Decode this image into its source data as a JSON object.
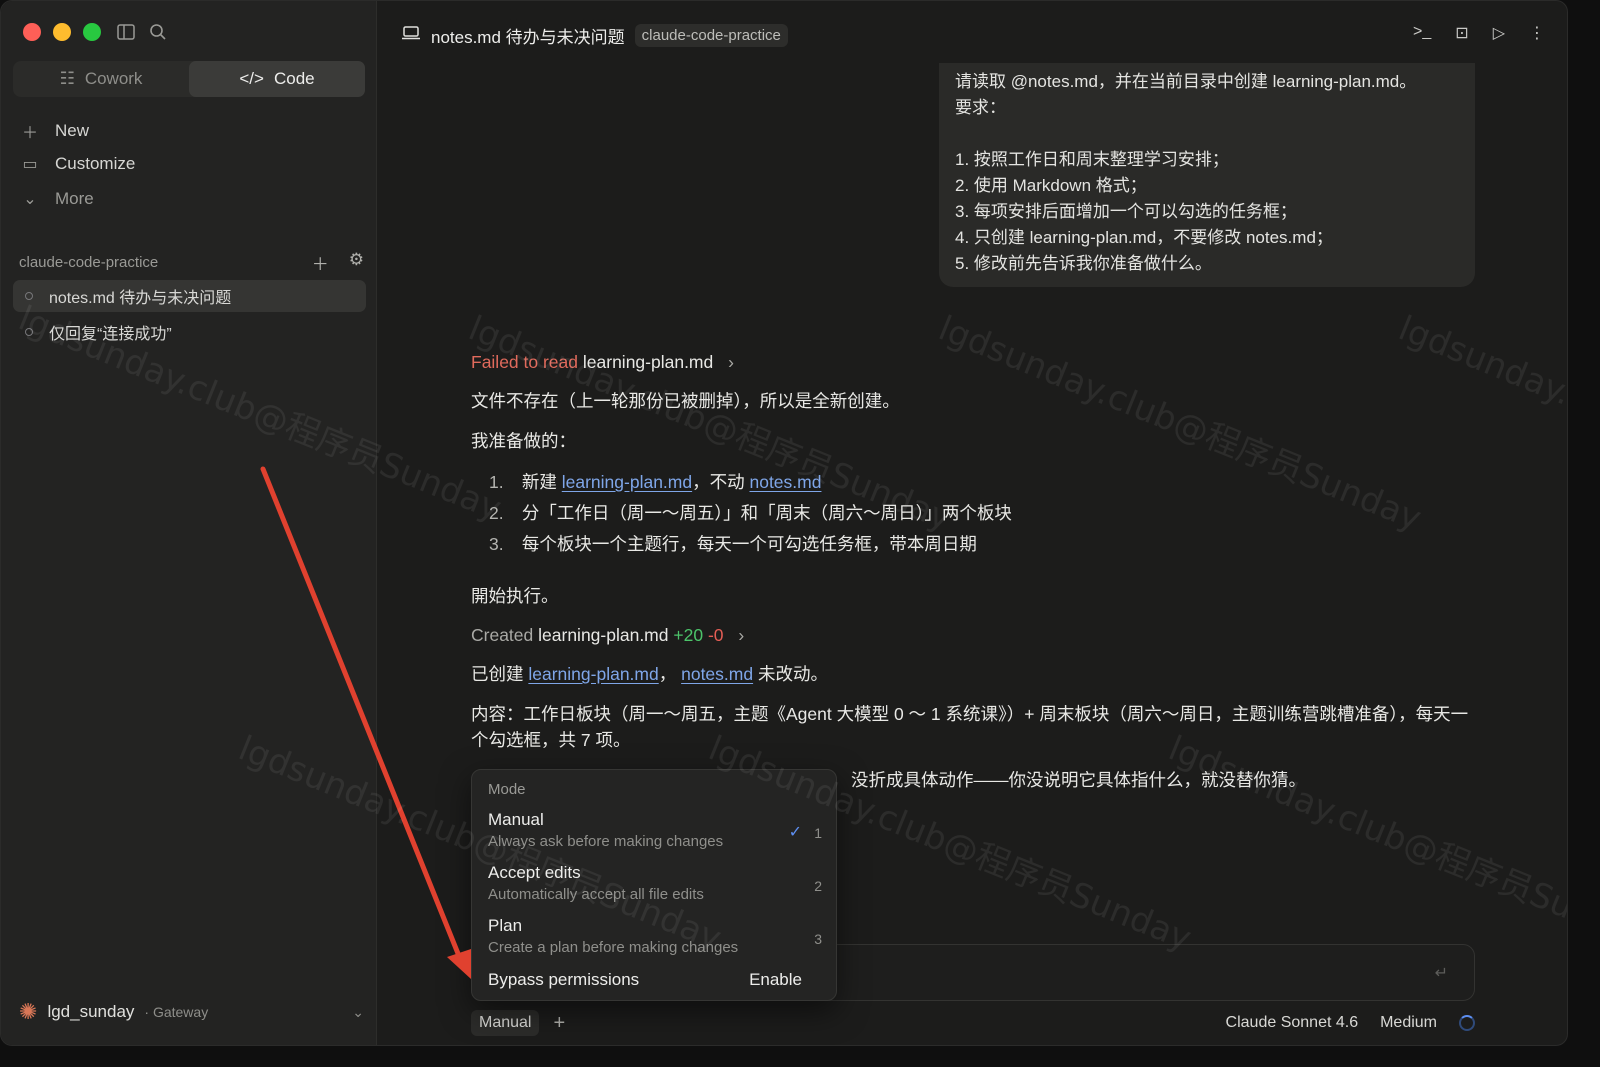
{
  "sidebar": {
    "switch": {
      "cowork": "Cowork",
      "code": "Code"
    },
    "nav": {
      "new": "New",
      "customize": "Customize",
      "more": "More"
    },
    "project": "claude-code-practice",
    "sessions": [
      "notes.md 待办与未决问题",
      "仅回复“连接成功”"
    ],
    "user": {
      "name": "lgd_sunday",
      "gateway": "· Gateway"
    }
  },
  "topbar": {
    "title": "notes.md 待办与未决问题",
    "tag": "claude-code-practice"
  },
  "user_message": {
    "line1": "请读取 @notes.md，并在当前目录中创建 learning-plan.md。",
    "line2": "要求：",
    "items": [
      "1. 按照工作日和周末整理学习安排；",
      "2. 使用 Markdown 格式；",
      "3. 每项安排后面增加一个可以勾选的任务框；",
      "4. 只创建 learning-plan.md，不要修改 notes.md；",
      "5. 修改前先告诉我你准备做什么。"
    ]
  },
  "assistant": {
    "failed_label": "Failed to read",
    "failed_file": "learning-plan.md",
    "p1": "文件不存在（上一轮那份已被删掉），所以是全新创建。",
    "p2": "我准备做的：",
    "step1_pre": "新建",
    "step1_link1": "learning-plan.md",
    "step1_mid": "，不动",
    "step1_link2": "notes.md",
    "step2": "分「工作日（周一～周五）」和「周末（周六～周日）」两个板块",
    "step3": "每个板块一个主题行，每天一个可勾选任务框，带本周日期",
    "nums": [
      "1.",
      "2.",
      "3."
    ],
    "p3": "開始执行。",
    "created_label": "Created",
    "created_file": "learning-plan.md",
    "added": "+20",
    "removed": "-0",
    "p4_pre": "已创建",
    "p4_link1": "learning-plan.md",
    "p4_sep": "，",
    "p4_link2": "notes.md",
    "p4_post": "未改动。",
    "p5": "内容：工作日板块（周一～周五，主题《Agent 大模型 0 ～ 1 系统课》）+ 周末板块（周六～周日，主题训练营跳槽准备），每天一个勾选框，共 7 项。",
    "p6": "没折成具体动作——你没说明它具体指什么，就没替你猜。"
  },
  "mode_menu": {
    "header": "Mode",
    "options": [
      {
        "title": "Manual",
        "desc": "Always ask before making changes",
        "key": "1"
      },
      {
        "title": "Accept edits",
        "desc": "Automatically accept all file edits",
        "key": "2"
      },
      {
        "title": "Plan",
        "desc": "Create a plan before making changes",
        "key": "3"
      }
    ],
    "bypass": "Bypass permissions",
    "enable": "Enable"
  },
  "bottom": {
    "mode_chip": "Manual",
    "add": "+",
    "model": "Claude Sonnet 4.6",
    "effort": "Medium"
  },
  "watermark": [
    "lgdsunday.club@程序员Sunday"
  ],
  "colors": {
    "accent": "#5d8ef0",
    "error": "#e06a5c",
    "added": "#4cc46a",
    "removed": "#e35d55",
    "annotation_arrow": "#e0412f"
  }
}
